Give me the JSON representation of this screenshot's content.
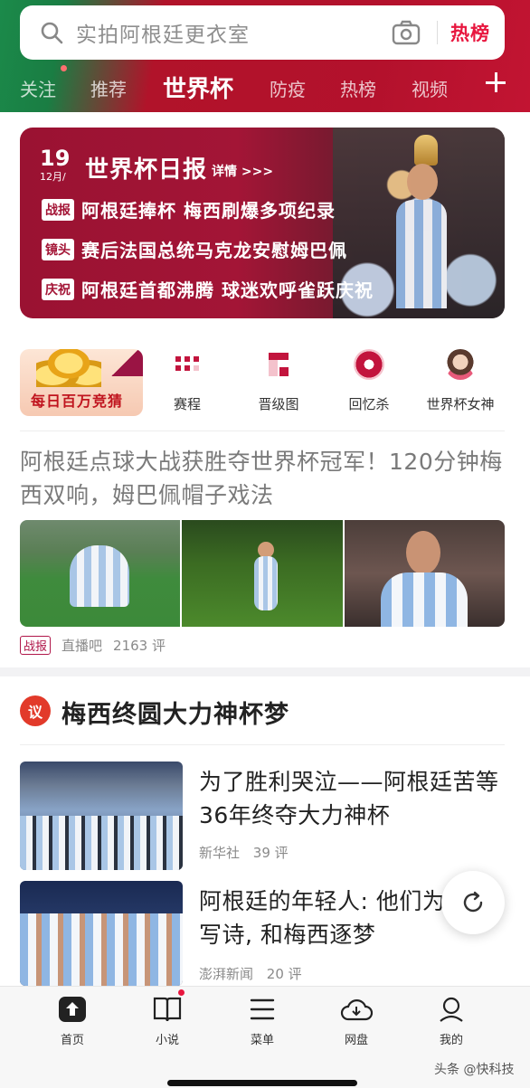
{
  "search": {
    "placeholder_text": "实拍阿根廷更衣室",
    "hot_label": "热榜"
  },
  "tabs": [
    {
      "label": "关注"
    },
    {
      "label": "推荐"
    },
    {
      "label": "世界杯"
    },
    {
      "label": "防疫"
    },
    {
      "label": "热榜"
    },
    {
      "label": "视频"
    }
  ],
  "banner": {
    "date_day": "19",
    "date_month": "12月/",
    "title": "世界杯日报",
    "detail": "详情 >>>",
    "items": [
      {
        "tag": "战报",
        "text": "阿根廷捧杯 梅西刷爆多项纪录"
      },
      {
        "tag": "镜头",
        "text": "赛后法国总统马克龙安慰姆巴佩"
      },
      {
        "tag": "庆祝",
        "text": "阿根廷首都沸腾 球迷欢呼雀跃庆祝"
      }
    ]
  },
  "quicknav": {
    "promo_label": "每日百万竞猜",
    "items": [
      {
        "label": "赛程"
      },
      {
        "label": "晋级图"
      },
      {
        "label": "回忆杀"
      },
      {
        "label": "世界杯女神"
      }
    ]
  },
  "article": {
    "headline": "阿根廷点球大战获胜夺世界杯冠军！120分钟梅西双响，姆巴佩帽子戏法",
    "tag": "战报",
    "source": "直播吧",
    "comments": "2163 评"
  },
  "section": {
    "icon_text": "议",
    "title": "梅西终圆大力神杯梦",
    "items": [
      {
        "title": "为了胜利哭泣——阿根廷苦等36年终夺大力神杯",
        "source": "新华社",
        "comments": "39 评"
      },
      {
        "title": "阿根廷的年轻人: 他们为梅西写诗, 和梅西逐梦",
        "source": "澎湃新闻",
        "comments": "20 评"
      }
    ]
  },
  "bottom_nav": [
    {
      "label": "首页"
    },
    {
      "label": "小说"
    },
    {
      "label": "菜单"
    },
    {
      "label": "网盘"
    },
    {
      "label": "我的"
    }
  ],
  "watermark": "头条 @快科技",
  "colors": {
    "brand_red": "#b3112c",
    "green": "#1b8a4a",
    "accent": "#e8173f"
  }
}
